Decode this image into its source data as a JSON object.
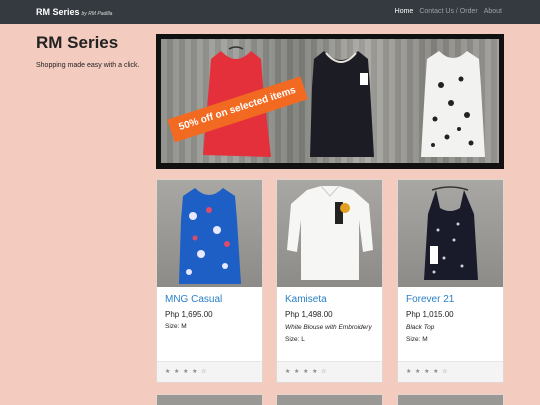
{
  "navbar": {
    "brand": "RM Series",
    "brand_sub": "by RM Padilla",
    "links": [
      {
        "label": "Home"
      },
      {
        "label": "Contact Us / Order"
      },
      {
        "label": "About"
      }
    ]
  },
  "sidebar": {
    "title": "RM Series",
    "tagline": "Shopping made easy with a click."
  },
  "hero": {
    "promo": "50% off on selected items"
  },
  "products": [
    {
      "name": "MNG Casual",
      "price": "Php 1,695.00",
      "description": "",
      "size": "Size: M",
      "rating": 4,
      "stars": "★ ★ ★ ★ ☆"
    },
    {
      "name": "Kamiseta",
      "price": "Php 1,498.00",
      "description": "White Blouse with Embroidery",
      "size": "Size: L",
      "rating": 4,
      "stars": "★ ★ ★ ★ ☆"
    },
    {
      "name": "Forever 21",
      "price": "Php 1,015.00",
      "description": "Black Top",
      "size": "Size: M",
      "rating": 4,
      "stars": "★ ★ ★ ★ ☆"
    }
  ],
  "colors": {
    "background": "#f4ccbf",
    "navbar": "#343a40",
    "link": "#2a7fc7",
    "promo": "#f26a22"
  }
}
